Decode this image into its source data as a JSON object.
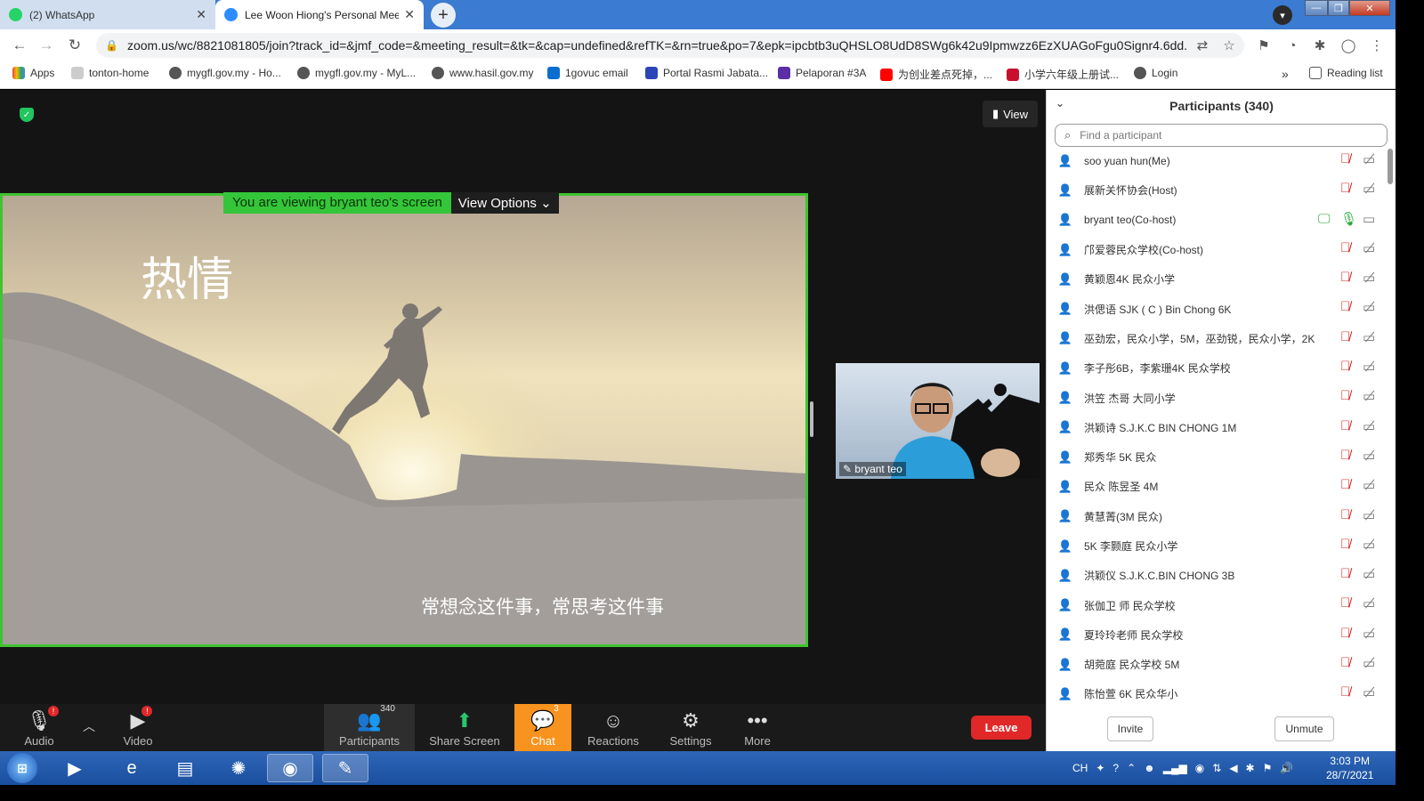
{
  "browser": {
    "tabs": [
      {
        "label": "(2) WhatsApp",
        "icon": "whatsapp-icon",
        "color": "#25d366"
      },
      {
        "label": "Lee Woon Hiong's Personal Mee",
        "icon": "zoom-icon",
        "color": "#2d8cff"
      }
    ],
    "address": "zoom.us/wc/8821081805/join?track_id=&jmf_code=&meeting_result=&tk=&cap=undefined&refTK=&rn=true&po=7&epk=ipcbtb3uQHSLO8UdD8SWg6k42u9Ipmwzz6EzXUAGoFgu0Signr4.6dd...",
    "bookmarks": [
      "Apps",
      "tonton-home",
      "mygfl.gov.my - Ho...",
      "mygfl.gov.my - MyL...",
      "www.hasil.gov.my",
      "1govuc email",
      "Portal Rasmi Jabata...",
      "Pelaporan #3A",
      "为创业差点死掉，...",
      "小学六年级上册试...",
      "Login"
    ],
    "reading_list": "Reading list",
    "overflow": "»"
  },
  "meeting": {
    "view_label": "View",
    "banner": "You are viewing bryant teo's screen",
    "view_options": "View Options",
    "slide_title": "热情",
    "slide_subtitle": "常想念这件事，常思考这件事",
    "thumbnail_name": "bryant teo"
  },
  "toolbar": {
    "audio": "Audio",
    "video": "Video",
    "participants": "Participants",
    "participants_count": "340",
    "share": "Share Screen",
    "chat": "Chat",
    "chat_count": "3",
    "reactions": "Reactions",
    "settings": "Settings",
    "more": "More",
    "leave": "Leave"
  },
  "panel": {
    "title": "Participants (340)",
    "search_placeholder": "Find a participant",
    "invite": "Invite",
    "unmute": "Unmute",
    "participants": [
      {
        "name": "soo yuan hun(Me)",
        "muted": true,
        "sharing": false
      },
      {
        "name": "展新关怀协会(Host)",
        "muted": true,
        "sharing": false
      },
      {
        "name": "bryant teo(Co-host)",
        "muted": false,
        "sharing": true
      },
      {
        "name": "邝爱蓉民众学校(Co-host)",
        "muted": true,
        "sharing": false
      },
      {
        "name": "黄颖恩4K 民众小学",
        "muted": true,
        "sharing": false
      },
      {
        "name": "洪偲语 SJK ( C ) Bin Chong 6K",
        "muted": true,
        "sharing": false
      },
      {
        "name": "巫劲宏，民众小学，5M，巫劲锐，民众小学，2K",
        "muted": true,
        "sharing": false
      },
      {
        "name": "李子彤6B，李紫珊4K 民众学校",
        "muted": true,
        "sharing": false
      },
      {
        "name": "洪笠 杰哥 大同小学",
        "muted": true,
        "sharing": false
      },
      {
        "name": "洪颖诗 S.J.K.C BIN CHONG 1M",
        "muted": true,
        "sharing": false
      },
      {
        "name": "郑秀华 5K 民众",
        "muted": true,
        "sharing": false
      },
      {
        "name": "民众 陈昱圣 4M",
        "muted": true,
        "sharing": false
      },
      {
        "name": "黄慧菁(3M 民众)",
        "muted": true,
        "sharing": false
      },
      {
        "name": "5K 李颢庭 民众小学",
        "muted": true,
        "sharing": false
      },
      {
        "name": "洪颖仪 S.J.K.C.BIN CHONG 3B",
        "muted": true,
        "sharing": false
      },
      {
        "name": "张伽卫 师 民众学校",
        "muted": true,
        "sharing": false
      },
      {
        "name": "夏玲玲老师 民众学校",
        "muted": true,
        "sharing": false
      },
      {
        "name": "胡菀庭 民众学校 5M",
        "muted": true,
        "sharing": false
      },
      {
        "name": "陈怡萱 6K 民众华小",
        "muted": true,
        "sharing": false
      }
    ]
  },
  "taskbar": {
    "lang": "CH",
    "time": "3:03 PM",
    "date": "28/7/2021"
  }
}
